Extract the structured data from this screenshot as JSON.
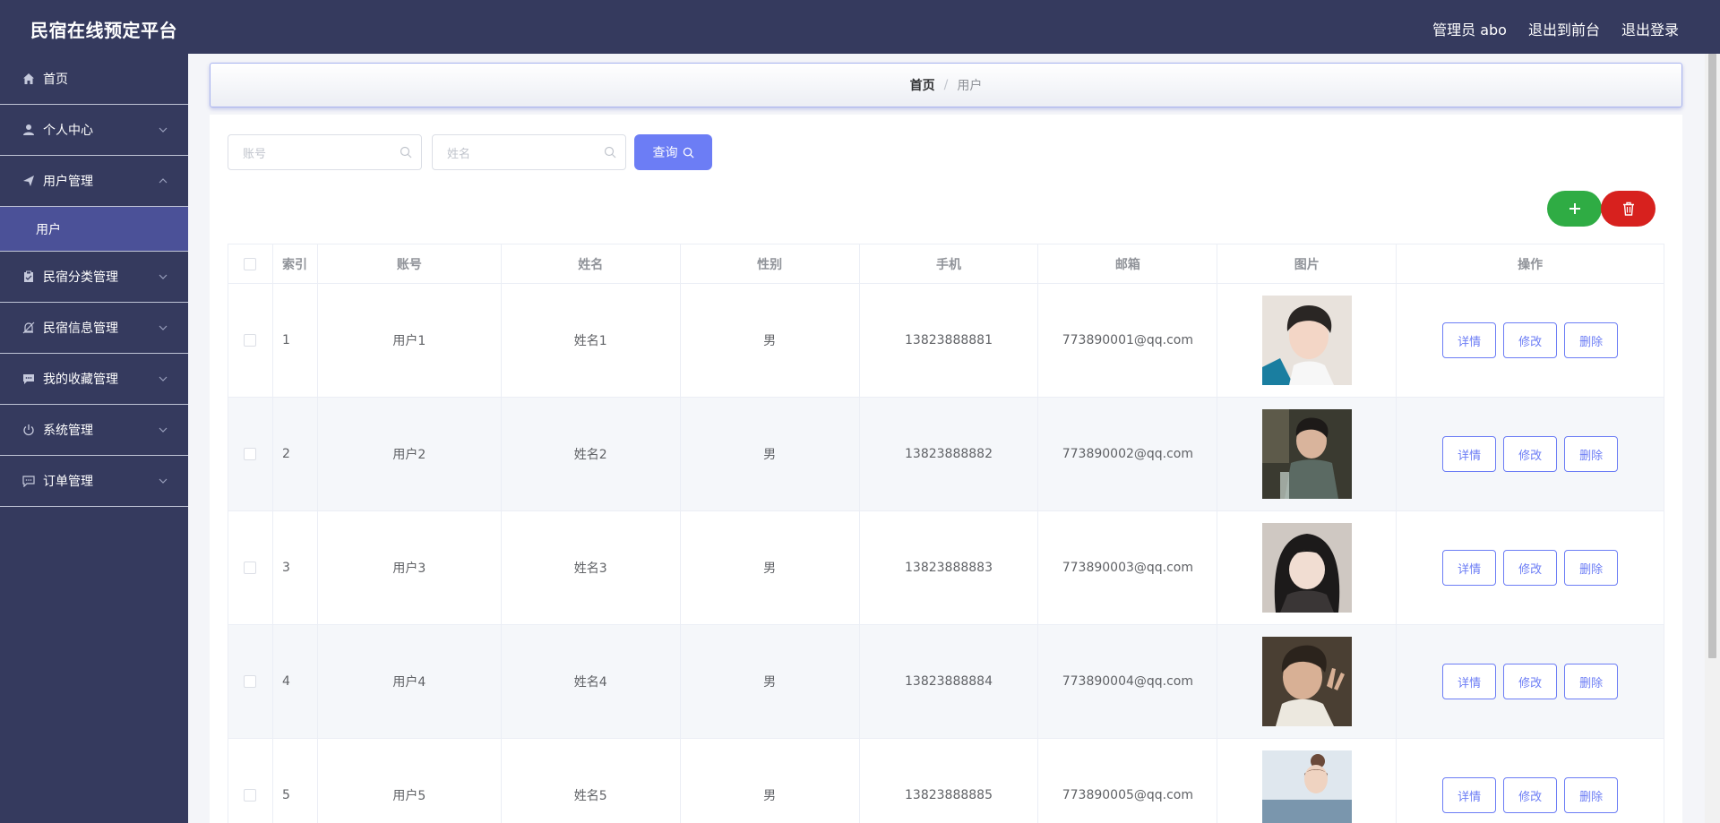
{
  "header": {
    "title": "民宿在线预定平台",
    "admin_label": "管理员 abo",
    "to_frontend": "退出到前台",
    "logout": "退出登录"
  },
  "sidebar": {
    "items": [
      {
        "label": "首页",
        "icon": "home-icon"
      },
      {
        "label": "个人中心",
        "icon": "user-icon"
      },
      {
        "label": "用户管理",
        "icon": "send-icon",
        "expanded": true,
        "children": [
          "用户"
        ]
      },
      {
        "label": "民宿分类管理",
        "icon": "clipboard-icon"
      },
      {
        "label": "民宿信息管理",
        "icon": "bell-off-icon"
      },
      {
        "label": "我的收藏管理",
        "icon": "chat-icon"
      },
      {
        "label": "系统管理",
        "icon": "power-icon"
      },
      {
        "label": "订单管理",
        "icon": "message-icon"
      }
    ]
  },
  "breadcrumb": {
    "home": "首页",
    "separator": "/",
    "current": "用户"
  },
  "search": {
    "account_placeholder": "账号",
    "name_placeholder": "姓名",
    "query_label": "查询"
  },
  "table": {
    "headers": [
      "",
      "索引",
      "账号",
      "姓名",
      "性别",
      "手机",
      "邮箱",
      "图片",
      "操作"
    ],
    "rows": [
      {
        "index": "1",
        "account": "用户1",
        "name": "姓名1",
        "gender": "男",
        "phone": "13823888881",
        "email": "773890001@qq.com"
      },
      {
        "index": "2",
        "account": "用户2",
        "name": "姓名2",
        "gender": "男",
        "phone": "13823888882",
        "email": "773890002@qq.com"
      },
      {
        "index": "3",
        "account": "用户3",
        "name": "姓名3",
        "gender": "男",
        "phone": "13823888883",
        "email": "773890003@qq.com"
      },
      {
        "index": "4",
        "account": "用户4",
        "name": "姓名4",
        "gender": "男",
        "phone": "13823888884",
        "email": "773890004@qq.com"
      },
      {
        "index": "5",
        "account": "用户5",
        "name": "姓名5",
        "gender": "男",
        "phone": "13823888885",
        "email": "773890005@qq.com"
      }
    ],
    "actions": {
      "detail": "详情",
      "edit": "修改",
      "delete": "删除"
    }
  },
  "colors": {
    "header_bg": "#353a5e",
    "active_submenu": "#4b5198",
    "accent": "#6c7df5",
    "add_button": "#2fac44",
    "delete_button": "#d7211e"
  }
}
